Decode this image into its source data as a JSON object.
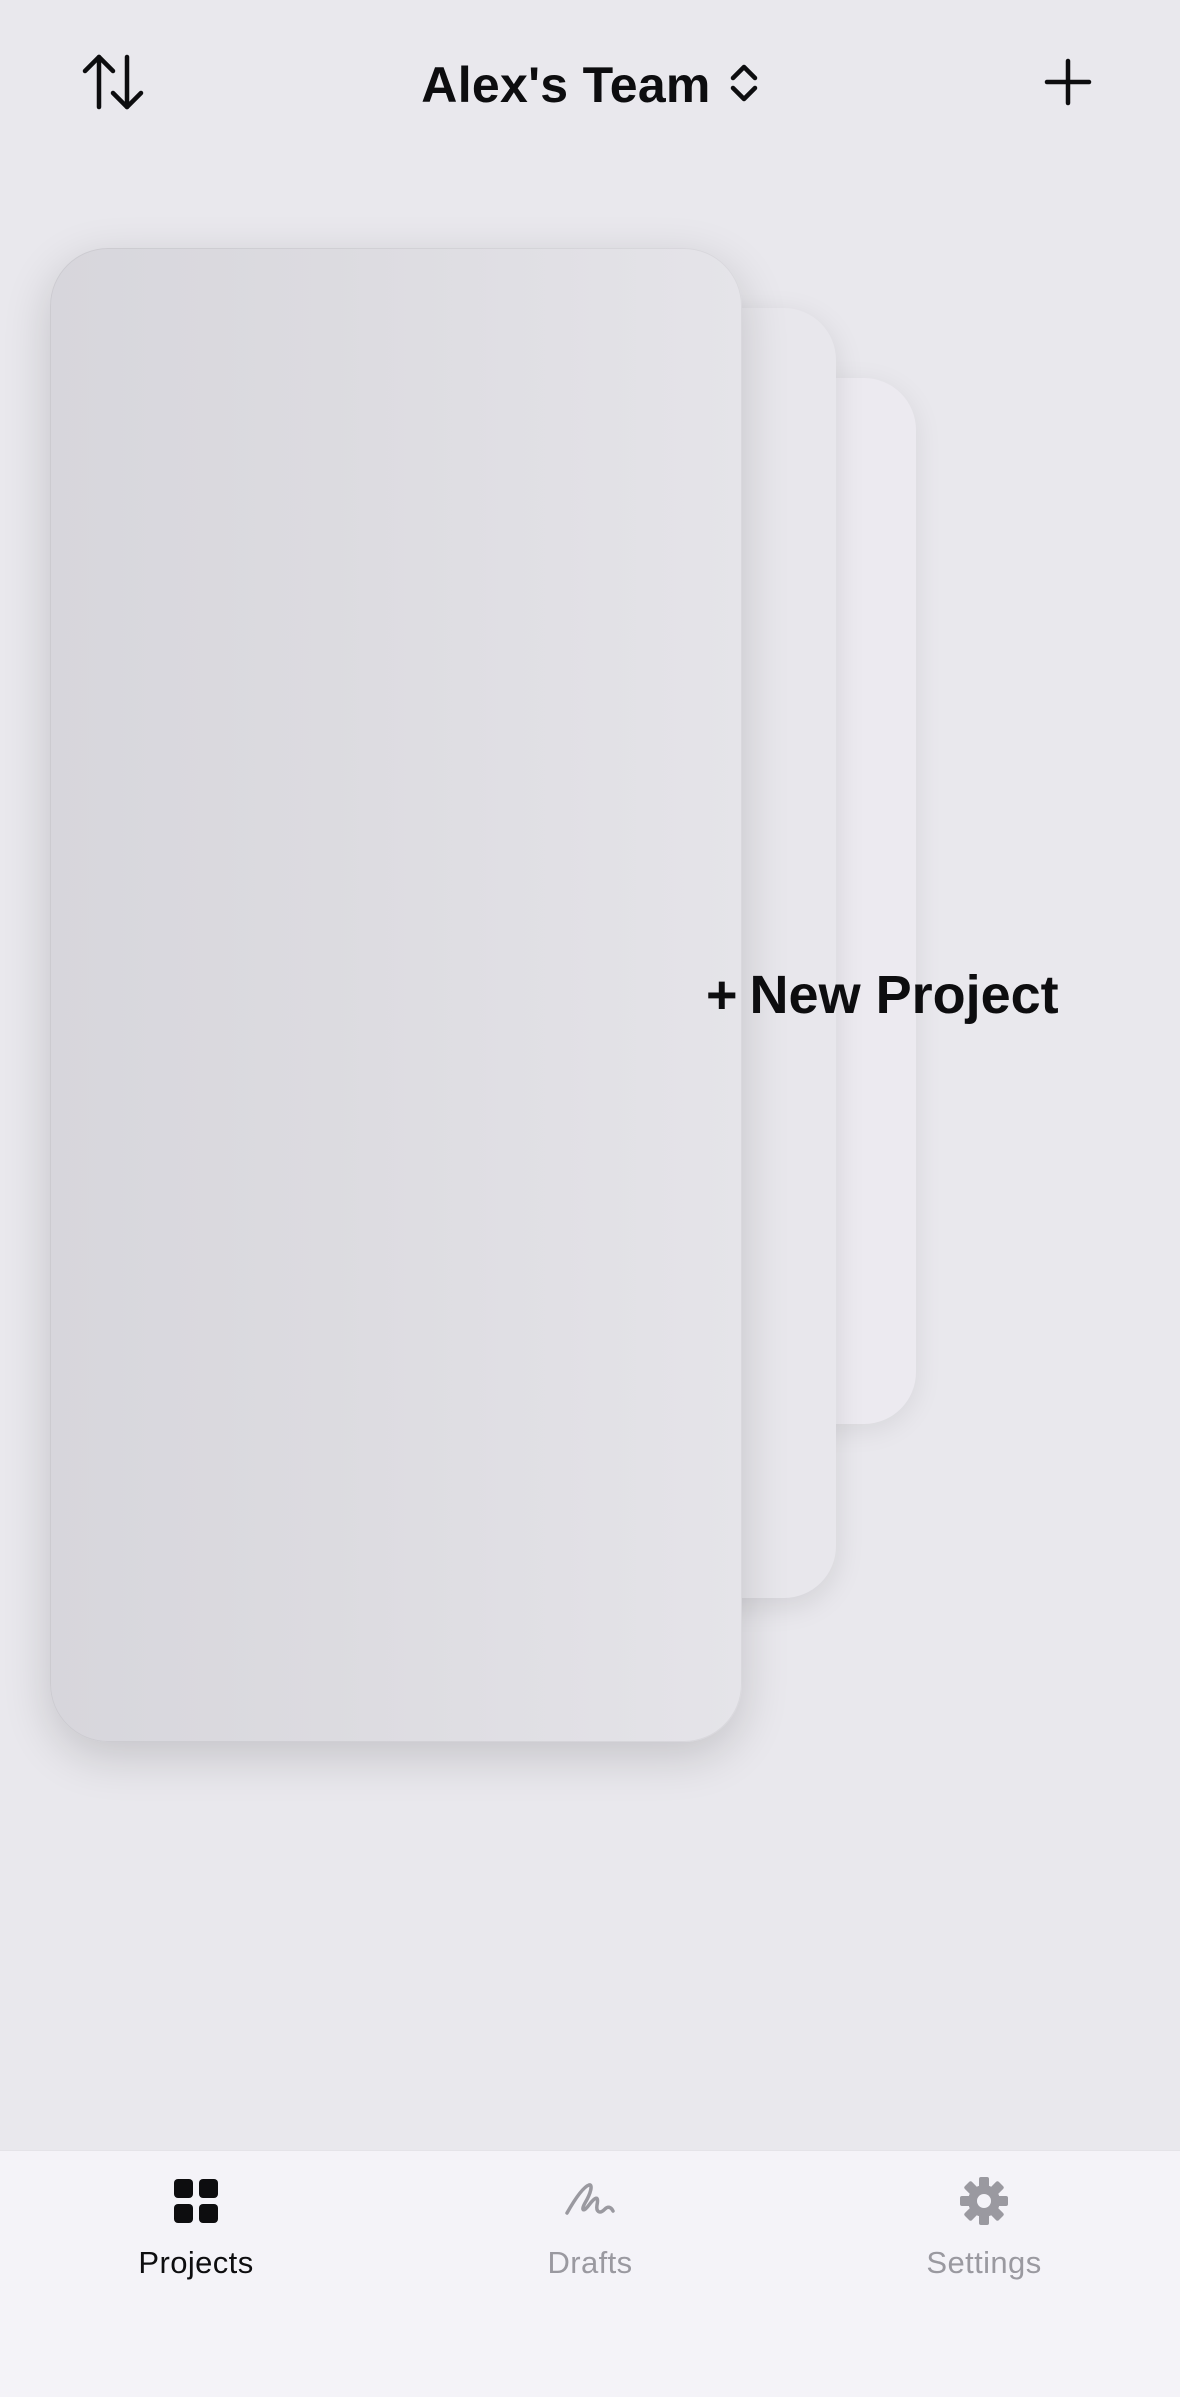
{
  "header": {
    "team_name": "Alex's Team",
    "sort_icon": "sort-arrows-icon",
    "team_selector_icon": "chevron-up-down-icon",
    "add_icon": "plus-icon"
  },
  "main": {
    "new_project_label": "New Project",
    "new_project_prefix": "+"
  },
  "tabbar": {
    "tabs": [
      {
        "label": "Projects",
        "icon": "grid-icon",
        "active": true
      },
      {
        "label": "Drafts",
        "icon": "scribble-icon",
        "active": false
      },
      {
        "label": "Settings",
        "icon": "gear-icon",
        "active": false
      }
    ]
  },
  "colors": {
    "background": "#e9e8ed",
    "tabbar_background": "#f4f3f8",
    "active_tab": "#0d0d0f",
    "inactive_tab": "#9a99a0"
  }
}
